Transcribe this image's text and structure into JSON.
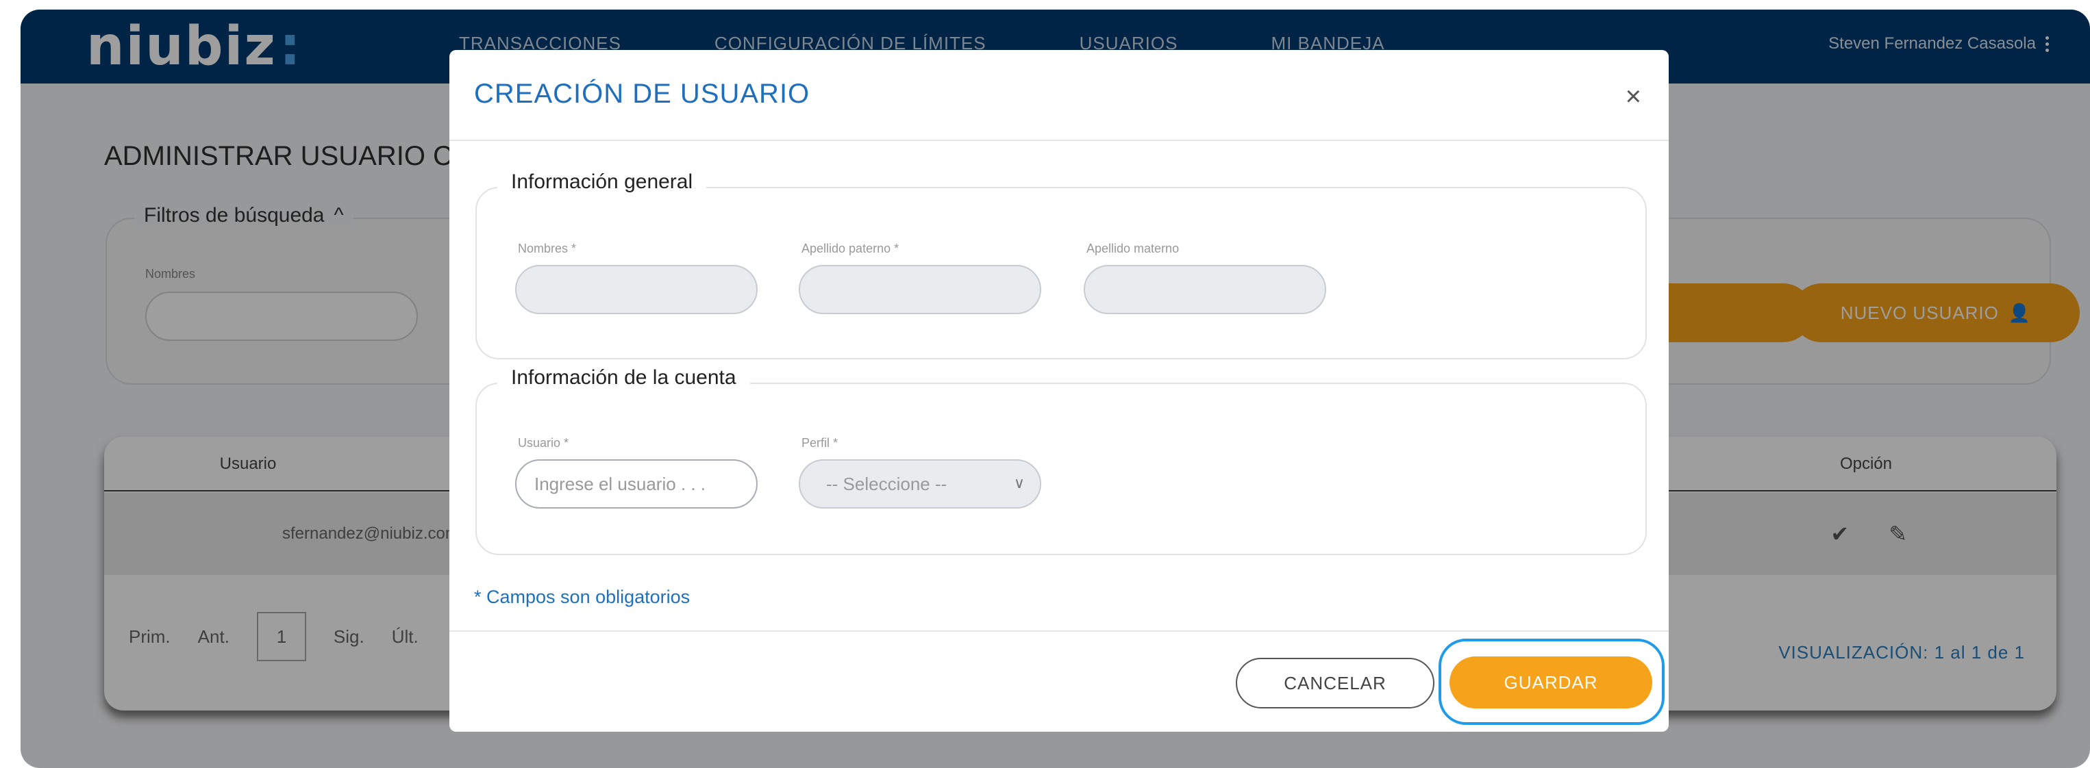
{
  "brand": {
    "logo_text": "niubiz",
    "logo_suffix": ":"
  },
  "nav": {
    "items": [
      "TRANSACCIONES",
      "CONFIGURACIÓN DE LÍMITES",
      "USUARIOS",
      "MI BANDEJA"
    ],
    "user_name": "Steven Fernandez Casasola"
  },
  "page": {
    "title": "ADMINISTRAR USUARIO CO",
    "filters_label": "Filtros de búsqueda",
    "filters_chevron": "^",
    "filter_field_label": "Nombres",
    "new_user_label": "NUEVO USUARIO"
  },
  "table": {
    "col_user": "Usuario",
    "col_option": "Opción",
    "row_user": "sfernandez@niubiz.com",
    "check_glyph": "✔",
    "edit_glyph": "✎",
    "pager": {
      "first": "Prim.",
      "prev": "Ant.",
      "current": "1",
      "next": "Sig.",
      "last": "Últ."
    },
    "visualization": "VISUALIZACIÓN: 1 al 1 de 1"
  },
  "modal": {
    "title": "CREACIÓN DE USUARIO",
    "close_glyph": "×",
    "section_general": "Información general",
    "label_nombres": "Nombres *",
    "label_apellido_paterno": "Apellido paterno *",
    "label_apellido_materno": "Apellido materno",
    "section_cuenta": "Información de la cuenta",
    "label_usuario": "Usuario *",
    "usuario_placeholder": "Ingrese el usuario . . .",
    "label_perfil": "Perfil *",
    "perfil_selected": "-- Seleccione --",
    "required_note": "* Campos son obligatorios",
    "cancel_label": "CANCELAR",
    "save_label": "GUARDAR"
  },
  "colors": {
    "brand_blue": "#003a70",
    "accent_orange": "#f6a21b",
    "link_blue": "#1f6fbf",
    "focus_ring": "#1e9be9"
  }
}
